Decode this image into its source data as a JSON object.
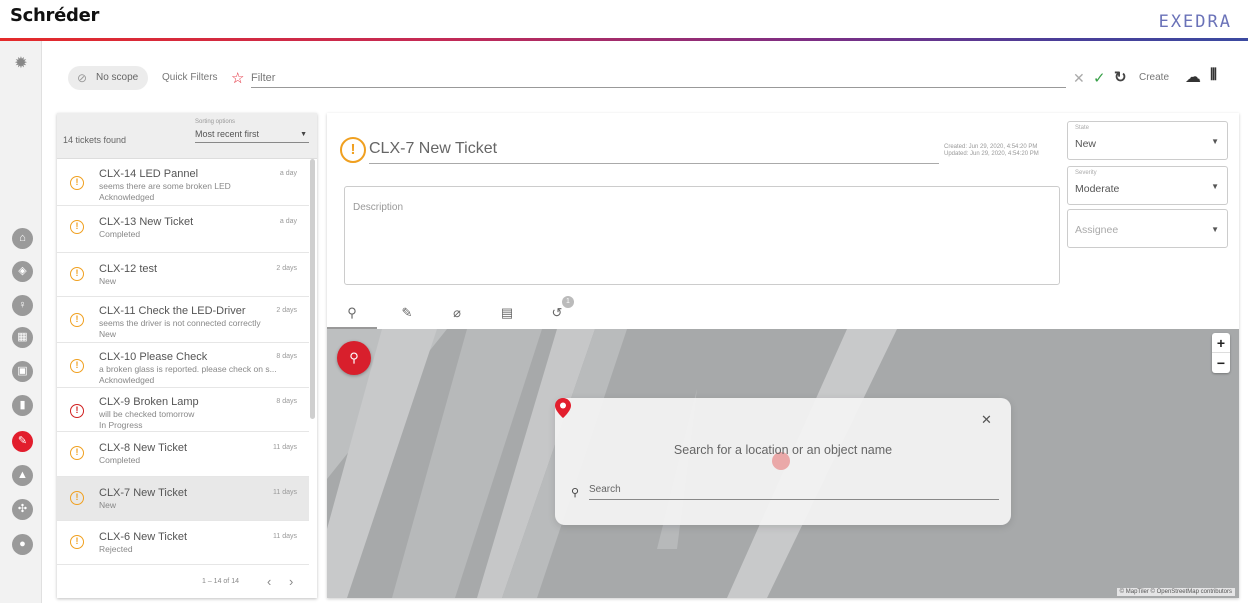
{
  "header": {
    "logo": "Schréder",
    "brand": "EXEDRA"
  },
  "rail": {
    "top_icon": "bug-icon",
    "items": [
      {
        "name": "home-icon",
        "glyph": "⌂"
      },
      {
        "name": "shield-icon",
        "glyph": "◈"
      },
      {
        "name": "lamp-icon",
        "glyph": "♀"
      },
      {
        "name": "cabinet-icon",
        "glyph": "▦"
      },
      {
        "name": "chart-icon",
        "glyph": "▣"
      },
      {
        "name": "battery-icon",
        "glyph": "▮"
      },
      {
        "name": "wrench-icon",
        "glyph": "✎"
      },
      {
        "name": "pole-icon",
        "glyph": "▲"
      },
      {
        "name": "network-icon",
        "glyph": "✣"
      },
      {
        "name": "user-icon",
        "glyph": "●"
      }
    ],
    "active_color": "#e21e2d"
  },
  "filterbar": {
    "scope": "No scope",
    "quick_filters": "Quick Filters",
    "filter_placeholder": "Filter",
    "create": "Create"
  },
  "list": {
    "found": "14 tickets found",
    "sort_label": "Sorting options",
    "sort_value": "Most recent first",
    "tickets": [
      {
        "title": "CLX-14 LED Pannel",
        "desc": "seems there are some broken LED",
        "state": "Acknowledged",
        "age": "a day",
        "severity": "orange"
      },
      {
        "title": "CLX-13 New Ticket",
        "desc": "",
        "state": "Completed",
        "age": "a day",
        "severity": "orange"
      },
      {
        "title": "CLX-12 test",
        "desc": "",
        "state": "New",
        "age": "2 days",
        "severity": "orange"
      },
      {
        "title": "CLX-11 Check the LED-Driver",
        "desc": "seems the driver is not connected correctly",
        "state": "New",
        "age": "2 days",
        "severity": "orange"
      },
      {
        "title": "CLX-10 Please Check",
        "desc": "a broken glass is reported. please check on s...",
        "state": "Acknowledged",
        "age": "8 days",
        "severity": "orange"
      },
      {
        "title": "CLX-9 Broken Lamp",
        "desc": "will be checked tomorrow",
        "state": "In Progress",
        "age": "8 days",
        "severity": "red"
      },
      {
        "title": "CLX-8 New Ticket",
        "desc": "",
        "state": "Completed",
        "age": "11 days",
        "severity": "orange"
      },
      {
        "title": "CLX-7 New Ticket",
        "desc": "",
        "state": "New",
        "age": "11 days",
        "severity": "orange"
      },
      {
        "title": "CLX-6 New Ticket",
        "desc": "",
        "state": "Rejected",
        "age": "11 days",
        "severity": "orange"
      }
    ],
    "pager": "1 – 14 of 14"
  },
  "detail": {
    "title": "CLX-7 New Ticket",
    "created": "Created: Jun 29, 2020, 4:54:20 PM",
    "updated": "Updated: Jun 29, 2020, 4:54:20 PM",
    "description_placeholder": "Description",
    "state_label": "State",
    "state_value": "New",
    "severity_label": "Severity",
    "severity_value": "Moderate",
    "assignee_placeholder": "Assignee",
    "tabs": [
      {
        "name": "location-tab-icon",
        "glyph": "⚲"
      },
      {
        "name": "wrench-tab-icon",
        "glyph": "✎"
      },
      {
        "name": "attachment-tab-icon",
        "glyph": "⌀"
      },
      {
        "name": "comment-tab-icon",
        "glyph": "▤"
      },
      {
        "name": "history-tab-icon",
        "glyph": "↺",
        "badge": "1"
      }
    ]
  },
  "map": {
    "attribution": "© MapTiler © OpenStreetMap contributors",
    "search_prompt": "Search for a location or an object name",
    "search_placeholder": "Search",
    "zoom_in": "+",
    "zoom_out": "−"
  }
}
